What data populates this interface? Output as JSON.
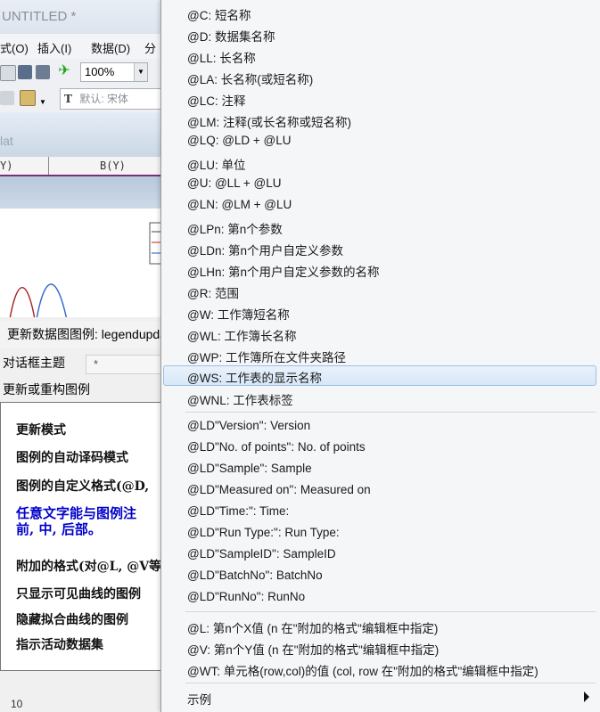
{
  "app": {
    "title": "UNTITLED *",
    "menus": [
      "式(O)",
      "插入(I)",
      "数据(D)",
      "分"
    ],
    "zoom": "100%",
    "font_placeholder": "默认: 宋体",
    "flat_label": "lat",
    "col_headers": [
      "Y)",
      "B(Y)"
    ]
  },
  "dialog": {
    "title": "更新数据图图例: legendupdate",
    "topic_label": "对话框主题",
    "topic_value": "*",
    "update_label": "更新或重构图例",
    "help_lines": [
      "更新模式",
      "图例的自动译码模式",
      "图例的自定义格式(@D,",
      "任意文字能与图例注",
      "前, 中, 后部。",
      "附加的格式(对@L, @V等",
      "只显示可见曲线的图例",
      "隐藏拟合曲线的图例",
      "指示活动数据集"
    ],
    "ruler_text": "10"
  },
  "menu": {
    "items": [
      "@C: 短名称",
      "@D: 数据集名称",
      "@LL: 长名称",
      "@LA: 长名称(或短名称)",
      "@LC: 注释",
      "@LM: 注释(或长名称或短名称)",
      "@LQ: @LD + @LU",
      "@LU: 单位",
      "@U: @LL + @LU",
      "@LN: @LM + @LU",
      "@LPn: 第n个参数",
      "@LDn: 第n个用户自定义参数",
      "@LHn: 第n个用户自定义参数的名称",
      "@R: 范围",
      "@W: 工作簿短名称",
      "@WL: 工作簿长名称",
      "@WP: 工作簿所在文件夹路径",
      "@WS: 工作表的显示名称",
      "@WNL: 工作表标签"
    ],
    "highlighted": "@WS: 工作表的显示名称",
    "ld_items": [
      "@LD\"Version\": Version",
      "@LD\"No. of points\": No. of points",
      "@LD\"Sample\": Sample",
      "@LD\"Measured on\": Measured on",
      "@LD\"Time:\": Time:",
      "@LD\"Run Type:\": Run Type:",
      "@LD\"SampleID\": SampleID",
      "@LD\"BatchNo\": BatchNo",
      "@LD\"RunNo\": RunNo"
    ],
    "format_items": [
      "@L: 第n个X值 (n 在\"附加的格式\"编辑框中指定)",
      "@V: 第n个Y值 (n 在\"附加的格式\"编辑框中指定)",
      "@WT: 单元格(row,col)的值 (col, row 在\"附加的格式\"编辑框中指定)"
    ],
    "examples_label": "示例"
  },
  "colors": {
    "highlight": "#d7e7f8",
    "help_blue": "#0000cc",
    "column_rule": "#7a2e7a"
  }
}
